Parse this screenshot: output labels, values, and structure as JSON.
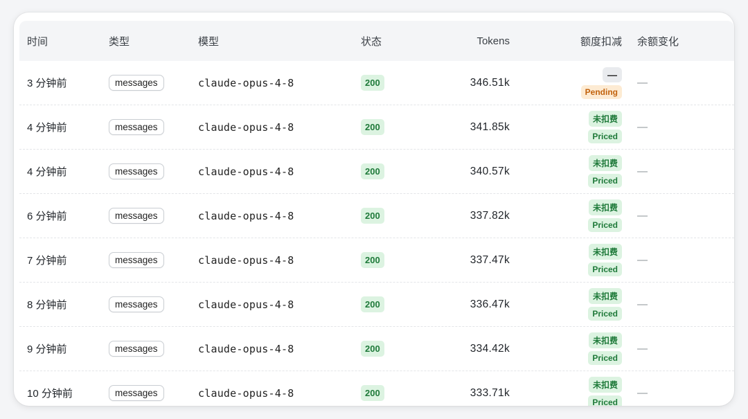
{
  "header": {
    "time": "时间",
    "type": "类型",
    "model": "模型",
    "status": "状态",
    "tokens": "Tokens",
    "deduction": "额度扣减",
    "balance_change": "余额变化"
  },
  "rows": [
    {
      "time": "3 分钟前",
      "type": "messages",
      "model": "claude-opus-4-8",
      "status": "200",
      "tokens": "346.51k",
      "deduct_top": "—",
      "deduct_bottom": "Pending",
      "balance": "—"
    },
    {
      "time": "4 分钟前",
      "type": "messages",
      "model": "claude-opus-4-8",
      "status": "200",
      "tokens": "341.85k",
      "deduct_top": "未扣费",
      "deduct_bottom": "Priced",
      "balance": "—"
    },
    {
      "time": "4 分钟前",
      "type": "messages",
      "model": "claude-opus-4-8",
      "status": "200",
      "tokens": "340.57k",
      "deduct_top": "未扣费",
      "deduct_bottom": "Priced",
      "balance": "—"
    },
    {
      "time": "6 分钟前",
      "type": "messages",
      "model": "claude-opus-4-8",
      "status": "200",
      "tokens": "337.82k",
      "deduct_top": "未扣费",
      "deduct_bottom": "Priced",
      "balance": "—"
    },
    {
      "time": "7 分钟前",
      "type": "messages",
      "model": "claude-opus-4-8",
      "status": "200",
      "tokens": "337.47k",
      "deduct_top": "未扣费",
      "deduct_bottom": "Priced",
      "balance": "—"
    },
    {
      "time": "8 分钟前",
      "type": "messages",
      "model": "claude-opus-4-8",
      "status": "200",
      "tokens": "336.47k",
      "deduct_top": "未扣费",
      "deduct_bottom": "Priced",
      "balance": "—"
    },
    {
      "time": "9 分钟前",
      "type": "messages",
      "model": "claude-opus-4-8",
      "status": "200",
      "tokens": "334.42k",
      "deduct_top": "未扣费",
      "deduct_bottom": "Priced",
      "balance": "—"
    },
    {
      "time": "10 分钟前",
      "type": "messages",
      "model": "claude-opus-4-8",
      "status": "200",
      "tokens": "333.71k",
      "deduct_top": "未扣费",
      "deduct_bottom": "Priced",
      "balance": "—"
    }
  ]
}
